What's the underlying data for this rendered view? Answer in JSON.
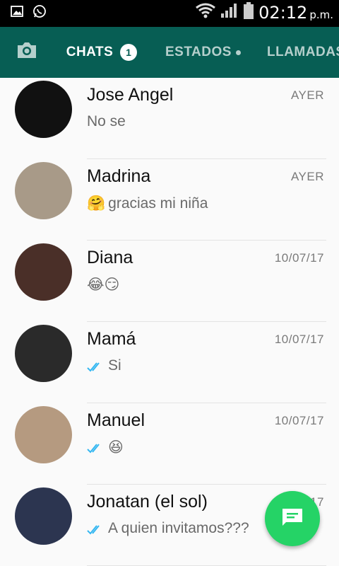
{
  "statusbar": {
    "time": "02:12",
    "time_suffix": "p.m."
  },
  "tabs": {
    "chats": {
      "label": "CHATS",
      "badge": "1"
    },
    "estados": {
      "label": "ESTADOS"
    },
    "llamadas": {
      "label": "LLAMADAS"
    }
  },
  "chats": [
    {
      "name": "Jose Angel",
      "time": "AYER",
      "preview": "No se",
      "emoji": "",
      "ticks": false,
      "avatar_color": "#111111"
    },
    {
      "name": "Madrina",
      "time": "AYER",
      "preview": "gracias mi niña",
      "emoji": "🤗",
      "ticks": false,
      "avatar_color": "#a89a88"
    },
    {
      "name": "Diana",
      "time": "10/07/17",
      "preview": "",
      "emoji": "😂😏",
      "ticks": false,
      "avatar_color": "#4a2f28"
    },
    {
      "name": "Mamá",
      "time": "10/07/17",
      "preview": "Si",
      "emoji": "",
      "ticks": true,
      "avatar_color": "#2a2a2a"
    },
    {
      "name": "Manuel",
      "time": "10/07/17",
      "preview": "",
      "emoji": "😆",
      "ticks": true,
      "avatar_color": "#b59a80"
    },
    {
      "name": "Jonatan (el sol)",
      "time": "10/07/17",
      "preview": "A quien invitamos???",
      "emoji": "",
      "ticks": true,
      "avatar_color": "#2c3550"
    }
  ],
  "colors": {
    "header": "#075e54",
    "fab": "#25d366",
    "ticks": "#34b7f1"
  }
}
